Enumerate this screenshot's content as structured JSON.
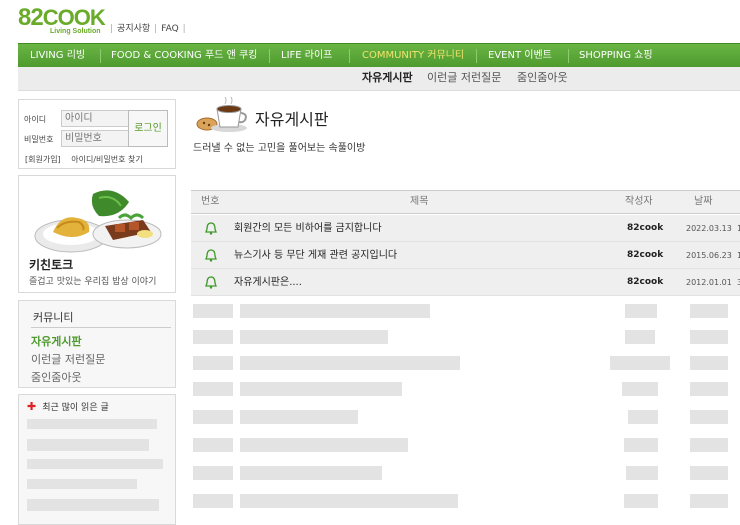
{
  "brand": {
    "logo": "82COOK",
    "logo_num": "82",
    "logo_word": "COOK",
    "tagline": "Living Solution"
  },
  "top_links": [
    "공지사항",
    "FAQ"
  ],
  "main_nav": [
    {
      "label": "LIVING 리빙"
    },
    {
      "label": "FOOD & COOKING 푸드 앤 쿠킹"
    },
    {
      "label": "LIFE 라이프"
    },
    {
      "label": "COMMUNITY 커뮤니티",
      "active": true
    },
    {
      "label": "EVENT 이벤트"
    },
    {
      "label": "SHOPPING 쇼핑"
    }
  ],
  "sub_nav": [
    {
      "label": "자유게시판",
      "active": true
    },
    {
      "label": "이런글 저런질문"
    },
    {
      "label": "줌인줌아웃"
    }
  ],
  "login": {
    "id_label": "아이디",
    "id_placeholder": "아이디",
    "pw_label": "비밀번호",
    "pw_placeholder": "비밀번호",
    "button": "로그인",
    "join": "[회원가입]",
    "find": "아이디/비밀번호 찾기"
  },
  "kitchen": {
    "title": "키친토크",
    "desc": "즐겁고 맛있는 우리집 밥상 이야기"
  },
  "community": {
    "heading": "커뮤니티",
    "links": [
      {
        "label": "자유게시판",
        "active": true
      },
      {
        "label": "이런글 저런질문"
      },
      {
        "label": "줌인줌아웃"
      }
    ]
  },
  "popular": {
    "heading": "최근 많이 읽은 글"
  },
  "board": {
    "title": "자유게시판",
    "description": "드러낼 수 없는 고민을 풀어보는 속풀이방",
    "columns": {
      "num": "번호",
      "subject": "제목",
      "author": "작성자",
      "date": "날짜"
    },
    "notices": [
      {
        "subject": "회원간의 모든 비하어를 금지합니다",
        "author": "82cook",
        "date": "2022.03.13",
        "extra": "1"
      },
      {
        "subject": "뉴스기사 등 무단 게재 관련 공지입니다",
        "author": "82cook",
        "date": "2015.06.23",
        "extra": "1"
      },
      {
        "subject": "자유게시판은....",
        "author": "82cook",
        "date": "2012.01.01",
        "extra": "3"
      }
    ]
  },
  "colors": {
    "brand_green": "#6aab2a",
    "nav_green": "#4e9a2e",
    "nav_active": "#f2e46b",
    "notice_bg": "#efefef"
  }
}
